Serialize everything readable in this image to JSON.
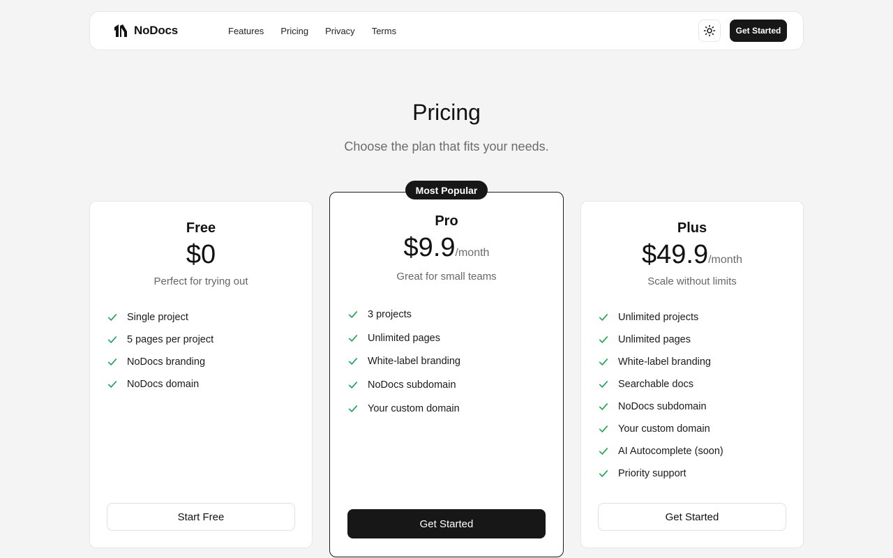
{
  "nav": {
    "brand": "NoDocs",
    "links": [
      "Features",
      "Pricing",
      "Privacy",
      "Terms"
    ],
    "cta": "Get Started"
  },
  "hero": {
    "title": "Pricing",
    "subtitle": "Choose the plan that fits your needs."
  },
  "plans": [
    {
      "name": "Free",
      "price": "$0",
      "period": "",
      "description": "Perfect for trying out",
      "features": [
        "Single project",
        "5 pages per project",
        "NoDocs branding",
        "NoDocs domain"
      ],
      "button": "Start Free"
    },
    {
      "name": "Pro",
      "badge": "Most Popular",
      "price": "$9.9",
      "period": "/month",
      "description": "Great for small teams",
      "features": [
        "3 projects",
        "Unlimited pages",
        "White-label branding",
        "NoDocs subdomain",
        "Your custom domain"
      ],
      "button": "Get Started"
    },
    {
      "name": "Plus",
      "price": "$49.9",
      "period": "/month",
      "description": "Scale without limits",
      "features": [
        "Unlimited projects",
        "Unlimited pages",
        "White-label branding",
        "Searchable docs",
        "NoDocs subdomain",
        "Your custom domain",
        "AI Autocomplete (soon)",
        "Priority support"
      ],
      "button": "Get Started"
    }
  ],
  "colors": {
    "accent": "#171717",
    "check": "#22a55a",
    "background": "#f4f4f4"
  },
  "icons": {
    "theme_toggle": "sun-icon",
    "feature": "check-icon"
  }
}
